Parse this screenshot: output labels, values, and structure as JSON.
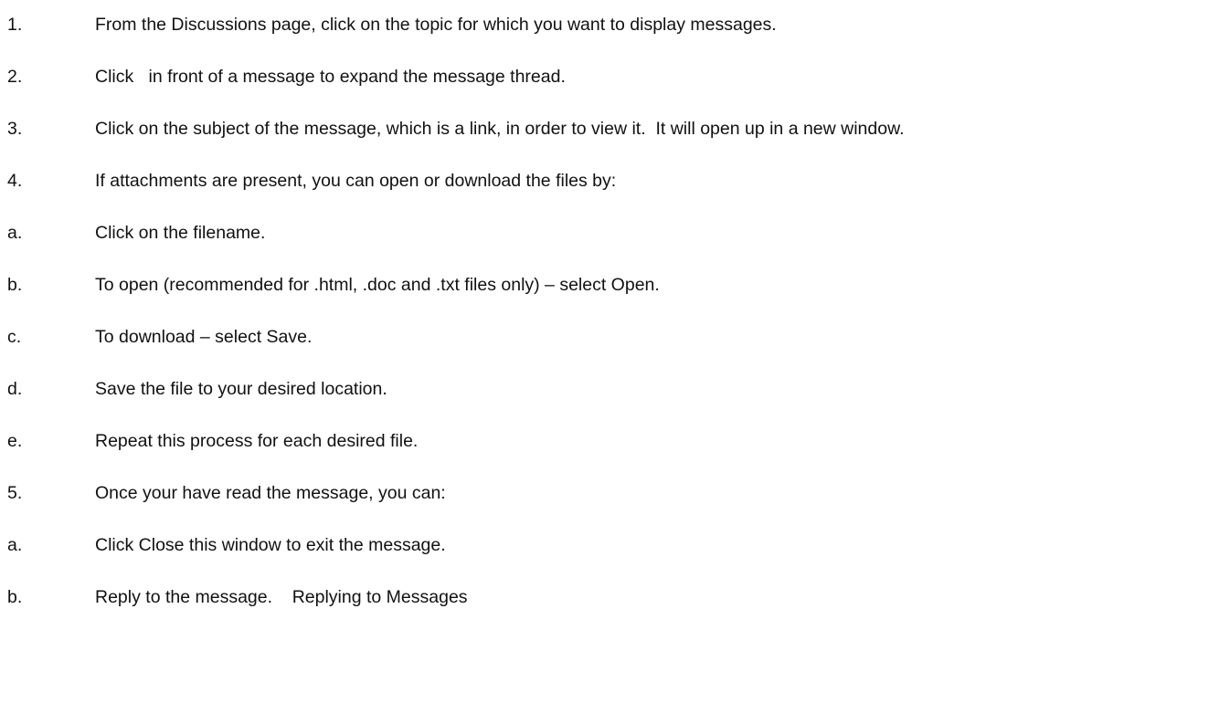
{
  "instructions": [
    {
      "marker": "1.",
      "text": "From the Discussions page, click on the topic for which you want to display messages."
    },
    {
      "marker": "2.",
      "text": "Click   in front of a message to expand the message thread."
    },
    {
      "marker": "3.",
      "text": "Click on the subject of the message, which is a link, in order to view it.  It will open up in a new window."
    },
    {
      "marker": "4.",
      "text": "If attachments are present, you can open or download the files by:"
    },
    {
      "marker": "a.",
      "text": "Click on the filename."
    },
    {
      "marker": "b.",
      "text": "To open (recommended for .html, .doc and .txt files only) – select Open."
    },
    {
      "marker": "c.",
      "text": "To download – select Save."
    },
    {
      "marker": "d.",
      "text": "Save the file to your desired location."
    },
    {
      "marker": "e.",
      "text": "Repeat this process for each desired file."
    },
    {
      "marker": "5.",
      "text": "Once your have read the message, you can:"
    },
    {
      "marker": "a.",
      "text": "Click Close this window to exit the message."
    },
    {
      "marker": "b.",
      "text": "Reply to the message.    ",
      "link": "Replying to Messages"
    }
  ]
}
